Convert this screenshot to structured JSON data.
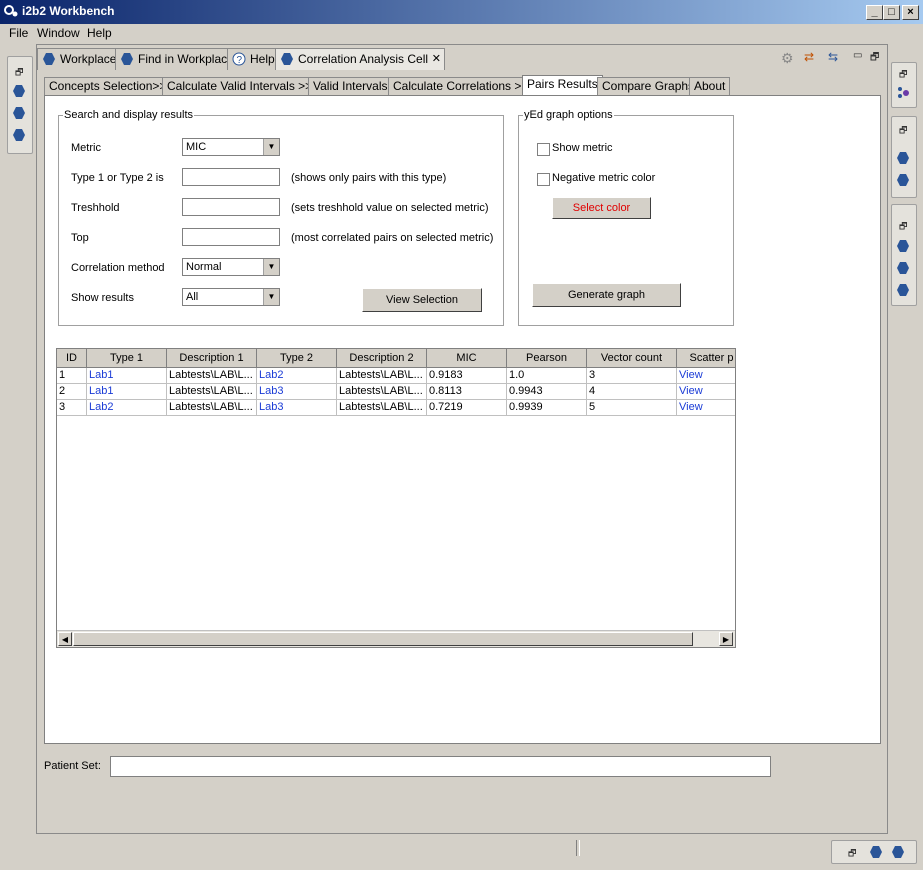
{
  "window": {
    "title": "i2b2 Workbench"
  },
  "menu": [
    "File",
    "Window",
    "Help"
  ],
  "view_tabs": [
    {
      "label": "Workplace"
    },
    {
      "label": "Find in Workplace"
    },
    {
      "label": "Help"
    },
    {
      "label": "Correlation Analysis Cell"
    }
  ],
  "inner_tabs": [
    "Concepts Selection>>",
    "Calculate Valid Intervals >>",
    "Valid Intervals",
    "Calculate Correlations >>",
    "Pairs Results",
    "Compare Graphs",
    "About"
  ],
  "search": {
    "legend": "Search and display results",
    "metric_label": "Metric",
    "metric_value": "MIC",
    "type_label": "Type 1 or Type 2 is",
    "type_hint": "(shows only pairs with this type)",
    "threshold_label": "Treshhold",
    "threshold_hint": "(sets treshhold value on selected metric)",
    "top_label": "Top",
    "top_hint": "(most correlated pairs on selected metric)",
    "method_label": "Correlation method",
    "method_value": "Normal",
    "show_label": "Show results",
    "show_value": "All",
    "view_button": "View Selection"
  },
  "yed": {
    "legend": "yEd graph options",
    "show_metric": "Show metric",
    "negative_color": "Negative metric color",
    "select_color": "Select color",
    "generate": "Generate graph",
    "accent": "#e00000"
  },
  "table": {
    "columns": [
      "ID",
      "Type 1",
      "Description 1",
      "Type 2",
      "Description 2",
      "MIC",
      "Pearson",
      "Vector count",
      "Scatter p"
    ],
    "rows": [
      [
        "1",
        "Lab1",
        "Labtests\\LAB\\L...",
        "Lab2",
        "Labtests\\LAB\\L...",
        "0.9183",
        "1.0",
        "3",
        "View"
      ],
      [
        "2",
        "Lab1",
        "Labtests\\LAB\\L...",
        "Lab3",
        "Labtests\\LAB\\L...",
        "0.8113",
        "0.9943",
        "4",
        "View"
      ],
      [
        "3",
        "Lab2",
        "Labtests\\LAB\\L...",
        "Lab3",
        "Labtests\\LAB\\L...",
        "0.7219",
        "0.9939",
        "5",
        "View"
      ]
    ]
  },
  "patient_set": {
    "label": "Patient Set:",
    "value": ""
  },
  "colors": {
    "link": "#1a3bd6",
    "hex_icon": "#2a5598",
    "titlebar": "#0a246a"
  }
}
